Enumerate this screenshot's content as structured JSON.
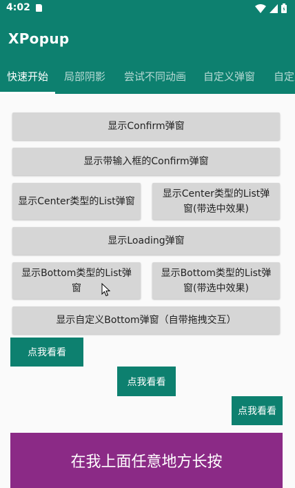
{
  "status_bar": {
    "time": "4:02"
  },
  "app_bar": {
    "title": "XPopup"
  },
  "tabs": [
    {
      "label": "快速开始",
      "active": true
    },
    {
      "label": "局部阴影"
    },
    {
      "label": "尝试不同动画"
    },
    {
      "label": "自定义弹窗"
    },
    {
      "label": "自定义"
    }
  ],
  "buttons": {
    "confirm": "显示Confirm弹窗",
    "input_confirm": "显示带输入框的Confirm弹窗",
    "center_list": "显示Center类型的List弹窗",
    "center_list_check": "显示Center类型的List弹窗(带选中效果)",
    "loading": "显示Loading弹窗",
    "bottom_list": "显示Bottom类型的List弹窗",
    "bottom_list_check": "显示Bottom类型的List弹窗(带选中效果)",
    "custom_bottom": "显示自定义Bottom弹窗（自带拖拽交互）"
  },
  "look_buttons": {
    "label": "点我看看"
  },
  "long_press_area": {
    "label": "在我上面任意地方长按"
  },
  "colors": {
    "primary": "#0d806f",
    "accent": "#8b2a86",
    "button_gray": "#d6d6d6"
  }
}
